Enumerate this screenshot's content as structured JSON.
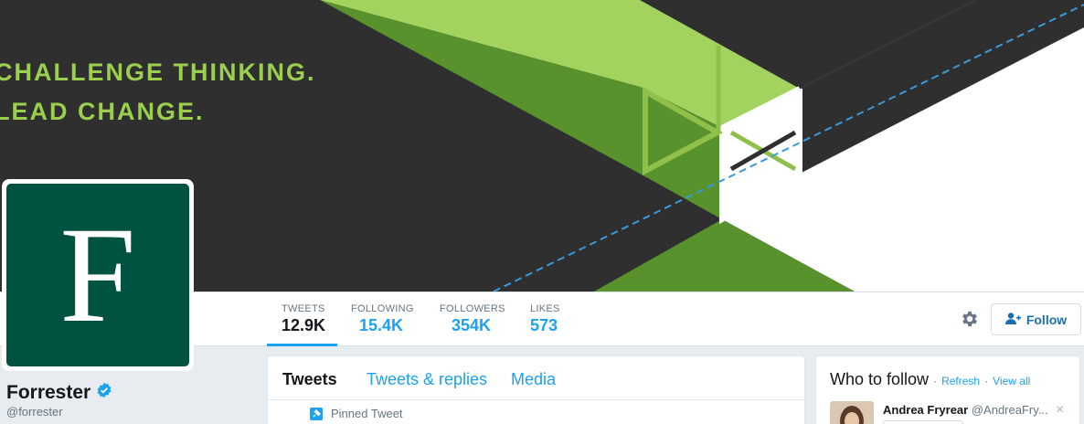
{
  "banner": {
    "line1": "CHALLENGE THINKING.",
    "line2": "LEAD CHANGE."
  },
  "profile": {
    "avatar_letter": "F",
    "name": "Forrester",
    "handle": "@forrester",
    "verified_icon": "verified-badge-icon"
  },
  "stats": [
    {
      "label": "TWEETS",
      "value": "12.9K"
    },
    {
      "label": "FOLLOWING",
      "value": "15.4K"
    },
    {
      "label": "FOLLOWERS",
      "value": "354K"
    },
    {
      "label": "LIKES",
      "value": "573"
    }
  ],
  "actions": {
    "follow_label": "Follow",
    "gear_icon": "gear-icon"
  },
  "timeline": {
    "tabs": [
      "Tweets",
      "Tweets & replies",
      "Media"
    ],
    "pinned_label": "Pinned Tweet"
  },
  "who_to_follow": {
    "title": "Who to follow",
    "sep": "·",
    "refresh": "Refresh",
    "view_all": "View all",
    "suggestion": {
      "name": "Andrea Fryrear",
      "handle": "@AndreaFry...",
      "close": "×"
    }
  },
  "colors": {
    "accent": "#1da1f2",
    "banner_green": "#9bcf4e",
    "banner_dark": "#2f2f30",
    "avatar_green": "#005340"
  }
}
